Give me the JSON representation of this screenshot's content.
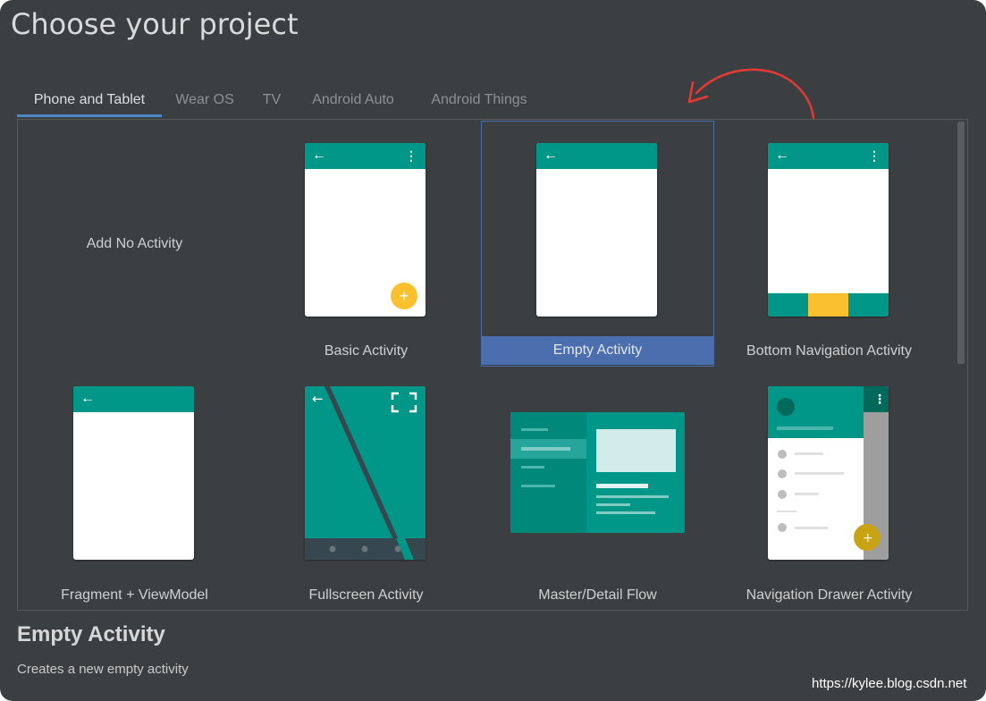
{
  "dialog": {
    "title": "Choose your project"
  },
  "tabs": [
    {
      "label": "Phone and Tablet",
      "active": true
    },
    {
      "label": "Wear OS",
      "active": false
    },
    {
      "label": "TV",
      "active": false
    },
    {
      "label": "Android Auto",
      "active": false
    },
    {
      "label": "Android Things",
      "active": false
    }
  ],
  "templates": [
    {
      "label": "Add No Activity",
      "selected": false
    },
    {
      "label": "Basic Activity",
      "selected": false
    },
    {
      "label": "Empty Activity",
      "selected": true
    },
    {
      "label": "Bottom Navigation Activity",
      "selected": false
    },
    {
      "label": "Fragment + ViewModel",
      "selected": false
    },
    {
      "label": "Fullscreen Activity",
      "selected": false
    },
    {
      "label": "Master/Detail Flow",
      "selected": false
    },
    {
      "label": "Navigation Drawer Activity",
      "selected": false
    }
  ],
  "description": {
    "title": "Empty Activity",
    "text": "Creates a new empty activity"
  },
  "watermark": "https://kylee.blog.csdn.net",
  "icons": {
    "back": "arrow-back-icon",
    "menu": "more-vert-icon",
    "fab": "plus-icon",
    "fullscreen": "fullscreen-icon"
  },
  "colors": {
    "teal": "#009688",
    "dark_teal": "#00796b",
    "amber": "#fbc02d",
    "selection": "#4b6eaf",
    "background": "#3c3f41",
    "annotation": "#e53935"
  }
}
